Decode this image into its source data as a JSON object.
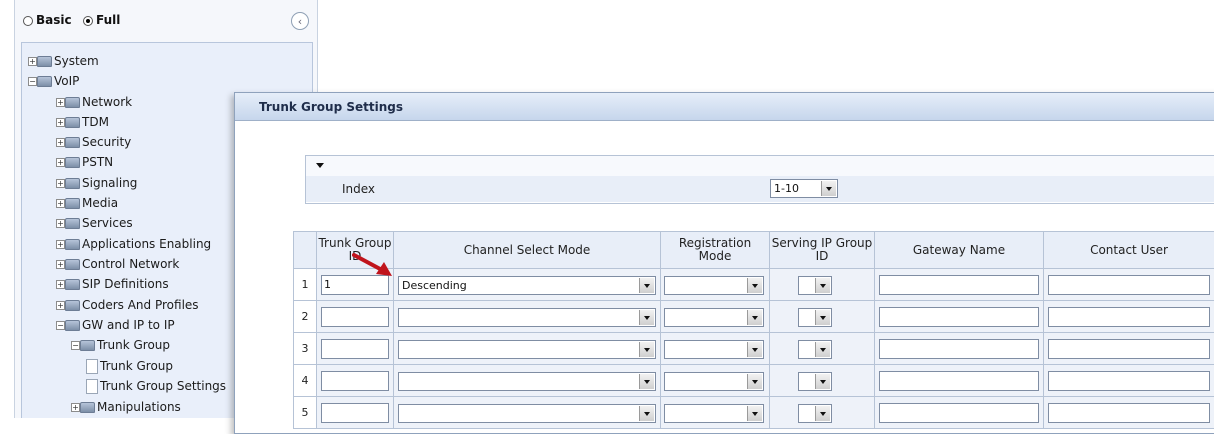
{
  "nav": {
    "mode_basic": "Basic",
    "mode_full": "Full",
    "selected_mode": "Full",
    "tree": [
      {
        "label": "System",
        "expander": "+"
      },
      {
        "label": "VoIP",
        "expander": "-"
      },
      {
        "label": "Network",
        "expander": "+"
      },
      {
        "label": "TDM",
        "expander": "+"
      },
      {
        "label": "Security",
        "expander": "+"
      },
      {
        "label": "PSTN",
        "expander": "+"
      },
      {
        "label": "Signaling",
        "expander": "+"
      },
      {
        "label": "Media",
        "expander": "+"
      },
      {
        "label": "Services",
        "expander": "+"
      },
      {
        "label": "Applications Enabling",
        "expander": "+"
      },
      {
        "label": "Control Network",
        "expander": "+"
      },
      {
        "label": "SIP Definitions",
        "expander": "+"
      },
      {
        "label": "Coders And Profiles",
        "expander": "+"
      },
      {
        "label": "GW and IP to IP",
        "expander": "-"
      },
      {
        "label": "Trunk Group",
        "expander": "-"
      },
      {
        "label": "Trunk Group",
        "expander": ""
      },
      {
        "label": "Trunk Group Settings",
        "expander": ""
      },
      {
        "label": "Manipulations",
        "expander": "+"
      }
    ]
  },
  "panel": {
    "title": "Trunk Group Settings",
    "index_label": "Index",
    "index_value": "1-10"
  },
  "table": {
    "headers": [
      "Trunk Group ID",
      "Channel Select Mode",
      "Registration Mode",
      "Serving IP Group ID",
      "Gateway Name",
      "Contact User"
    ],
    "rows": [
      {
        "num": "1",
        "trunk_group_id": "1",
        "channel_select_mode": "Descending",
        "registration_mode": "",
        "serving_ip_group_id": "",
        "gateway_name": "",
        "contact_user": ""
      },
      {
        "num": "2",
        "trunk_group_id": "",
        "channel_select_mode": "",
        "registration_mode": "",
        "serving_ip_group_id": "",
        "gateway_name": "",
        "contact_user": ""
      },
      {
        "num": "3",
        "trunk_group_id": "",
        "channel_select_mode": "",
        "registration_mode": "",
        "serving_ip_group_id": "",
        "gateway_name": "",
        "contact_user": ""
      },
      {
        "num": "4",
        "trunk_group_id": "",
        "channel_select_mode": "",
        "registration_mode": "",
        "serving_ip_group_id": "",
        "gateway_name": "",
        "contact_user": ""
      },
      {
        "num": "5",
        "trunk_group_id": "",
        "channel_select_mode": "",
        "registration_mode": "",
        "serving_ip_group_id": "",
        "gateway_name": "",
        "contact_user": ""
      }
    ]
  },
  "colors": {
    "callout_arrow": "#c0141c",
    "panel_header": "#c6d6ec",
    "tree_background": "#e9effa"
  },
  "icons": {
    "folder": "folder-icon",
    "page": "page-icon",
    "arrow": "red-arrow-icon"
  }
}
